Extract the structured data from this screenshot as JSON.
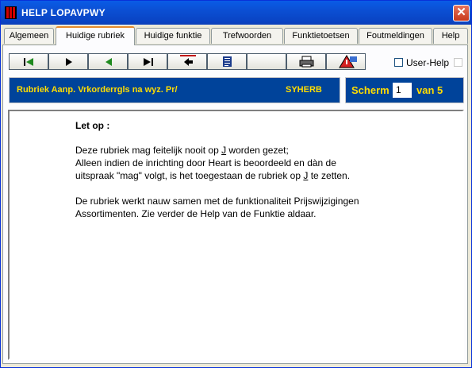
{
  "window": {
    "title": "HELP LOPAVPWY"
  },
  "tabs": [
    {
      "label": "Algemeen"
    },
    {
      "label": "Huidige rubriek"
    },
    {
      "label": "Huidige funktie"
    },
    {
      "label": "Trefwoorden"
    },
    {
      "label": "Funktietoetsen"
    },
    {
      "label": "Foutmeldingen"
    },
    {
      "label": "Help"
    }
  ],
  "active_tab": "Huidige rubriek",
  "toolbar": {
    "buttons": [
      "first-icon",
      "play-icon",
      "back-icon",
      "last-icon",
      "return-icon",
      "document-icon",
      "blank",
      "print-icon",
      "warning-icon"
    ]
  },
  "user_help": {
    "label": "User-Help",
    "checked": false
  },
  "header": {
    "rubriek": "Rubriek Aanp. Vrkorderrgls na wyz. Pr/",
    "code": "SYHERB",
    "scherm_label": "Scherm",
    "scherm_value": "1",
    "van_label": "van 5"
  },
  "help_text": {
    "title": "Let op :",
    "line1_pre": "Deze rubriek mag feitelijk nooit op ",
    "line1_u": "J",
    "line1_post": " worden gezet;",
    "line2": "Alleen indien de inrichting door Heart is beoordeeld en dàn de",
    "line3_pre": "uitspraak \"mag\" volgt, is het toegestaan de rubriek op ",
    "line3_u": "J",
    "line3_post": " te zetten.",
    "line4": "De rubriek werkt nauw samen met de funktionaliteit Prijswijzigingen",
    "line5": "Assortimenten. Zie verder de Help van de Funktie aldaar."
  }
}
